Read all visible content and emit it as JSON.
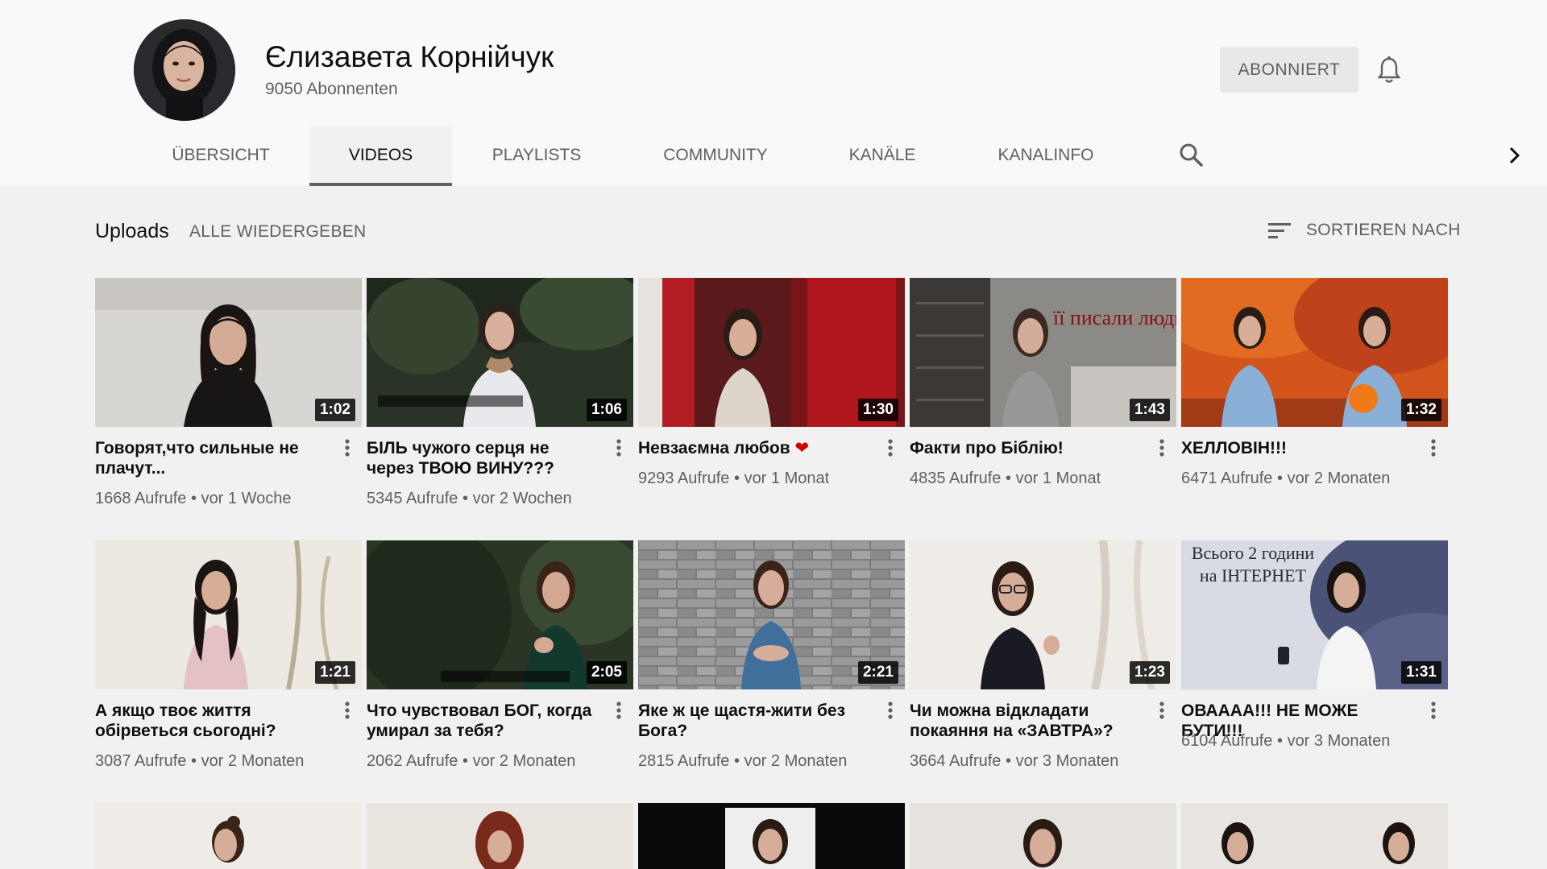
{
  "channel": {
    "name": "Єлизавета Корнійчук",
    "subscribers": "9050 Abonnenten",
    "subscribe_label": "ABONNIERT"
  },
  "tabs": [
    {
      "label": "ÜBERSICHT",
      "active": false
    },
    {
      "label": "VIDEOS",
      "active": true
    },
    {
      "label": "PLAYLISTS",
      "active": false
    },
    {
      "label": "COMMUNITY",
      "active": false
    },
    {
      "label": "KANÄLE",
      "active": false
    },
    {
      "label": "KANALINFO",
      "active": false
    }
  ],
  "icons": {
    "search": "search-icon",
    "next": "chevron-right-icon",
    "bell": "bell-icon",
    "sort": "sort-icon",
    "more": "more-vert-icon"
  },
  "section": {
    "title": "Uploads",
    "play_all": "ALLE WIEDERGEBEN",
    "sort": "SORTIEREN NACH"
  },
  "videos": [
    {
      "title": "Говорят,что сильные не плачут...",
      "views": "1668 Aufrufe",
      "age": "vor 1 Woche",
      "duration": "1:02"
    },
    {
      "title": "БІЛЬ чужого серця не через ТВОЮ ВИНУ???",
      "views": "5345 Aufrufe",
      "age": "vor 2 Wochen",
      "duration": "1:06"
    },
    {
      "title": "Невзаємна любов",
      "views": "9293 Aufrufe",
      "age": "vor 1 Monat",
      "duration": "1:30"
    },
    {
      "title": "Факти про Біблію!",
      "views": "4835 Aufrufe",
      "age": "vor 1 Monat",
      "duration": "1:43"
    },
    {
      "title": "ХЕЛЛОВІН!!!",
      "views": "6471 Aufrufe",
      "age": "vor 2 Monaten",
      "duration": "1:32"
    },
    {
      "title": "А якщо твоє життя обірветься сьогодні?",
      "views": "3087 Aufrufe",
      "age": "vor 2 Monaten",
      "duration": "1:21"
    },
    {
      "title": "Что чувствовал БОГ, когда умирал за тебя?",
      "views": "2062 Aufrufe",
      "age": "vor 2 Monaten",
      "duration": "2:05"
    },
    {
      "title": "Яке ж це щастя-жити без Бога?",
      "views": "2815 Aufrufe",
      "age": "vor 2 Monaten",
      "duration": "2:21"
    },
    {
      "title": "Чи можна відкладати покаяння на «ЗАВТРА»?",
      "views": "3664 Aufrufe",
      "age": "vor 3 Monaten",
      "duration": "1:23"
    },
    {
      "title": "ОВАААА!!! НЕ МОЖЕ БУТИ!!!",
      "views": "6104 Aufrufe",
      "age": "vor 3 Monaten",
      "duration": "1:31"
    }
  ],
  "thumb_text": {
    "fact": "її писали люди",
    "internet": "Всього 2 години на ІНТЕРНЕТ"
  },
  "colors": {
    "header_bg": "#f9f9f9",
    "page_bg": "#f1f1f1",
    "secondary_text": "#606060",
    "heart": "#cc0000"
  }
}
